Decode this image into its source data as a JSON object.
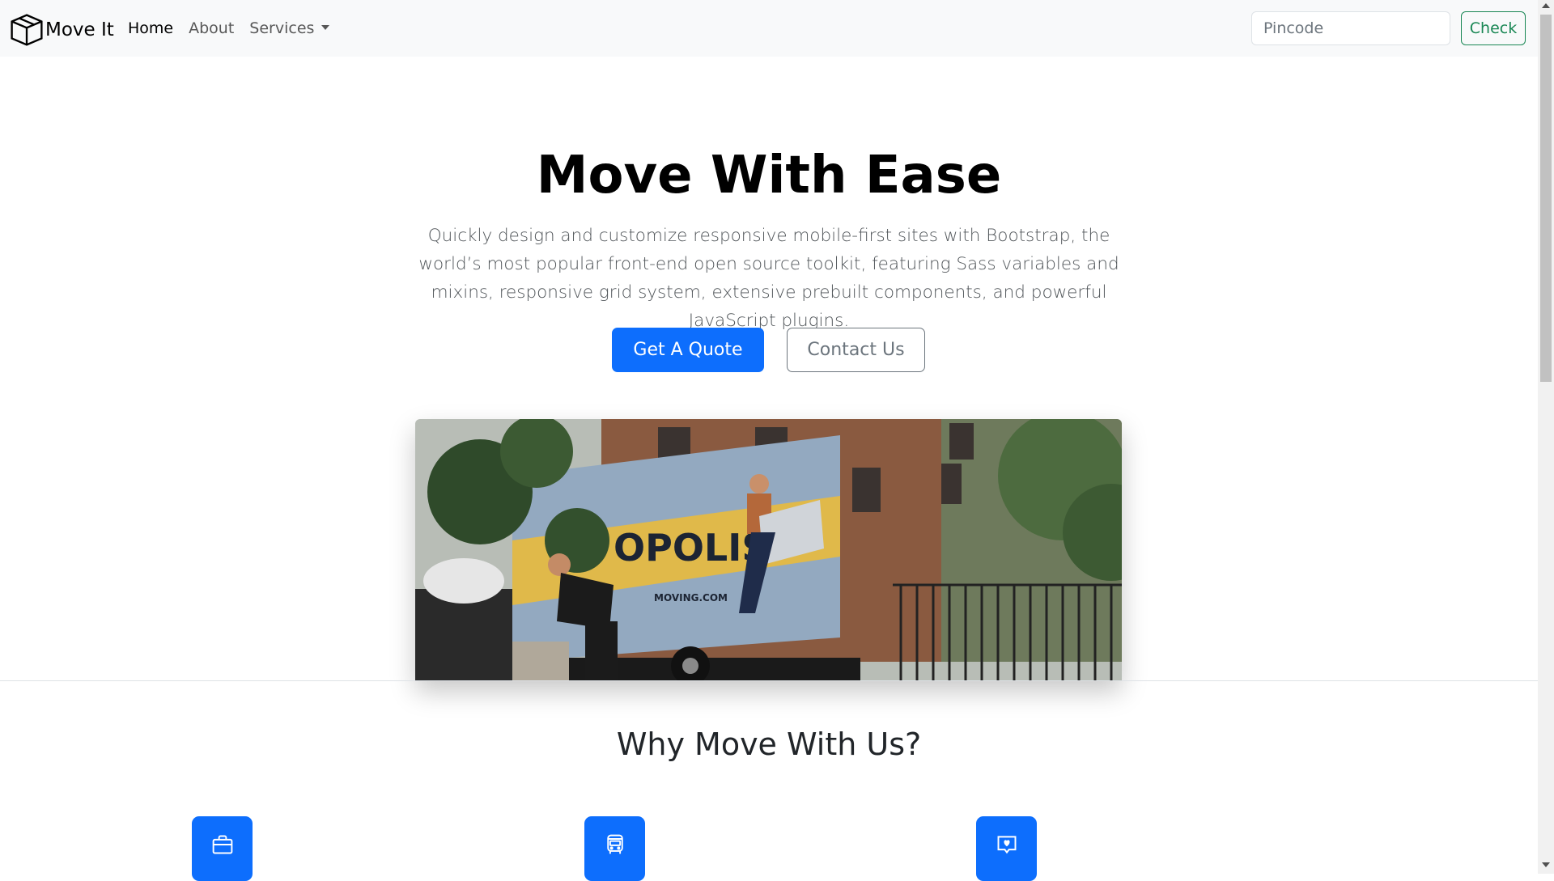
{
  "navbar": {
    "brand": "Move It",
    "links": [
      {
        "label": "Home",
        "active": true
      },
      {
        "label": "About"
      },
      {
        "label": "Services"
      }
    ],
    "search_placeholder": "Pincode",
    "check_label": "Check"
  },
  "hero": {
    "title": "Move With Ease",
    "lead": "Quickly design and customize responsive mobile-first sites with Bootstrap, the world’s most popular front-end open source toolkit, featuring Sass variables and mixins, responsive grid system, extensive prebuilt components, and powerful JavaScript plugins.",
    "primary_button": "Get A Quote",
    "secondary_button": "Contact Us",
    "image_truck_text": "OPOLIS",
    "image_url_text": "MOVING.COM"
  },
  "features": {
    "title": "Why Move With Us?",
    "icons": [
      "briefcase-icon",
      "bus-icon",
      "chat-heart-icon"
    ]
  },
  "colors": {
    "primary": "#0d6efd",
    "success": "#198754",
    "secondary": "#6c757d",
    "navbar_bg": "#f8f9fa"
  }
}
